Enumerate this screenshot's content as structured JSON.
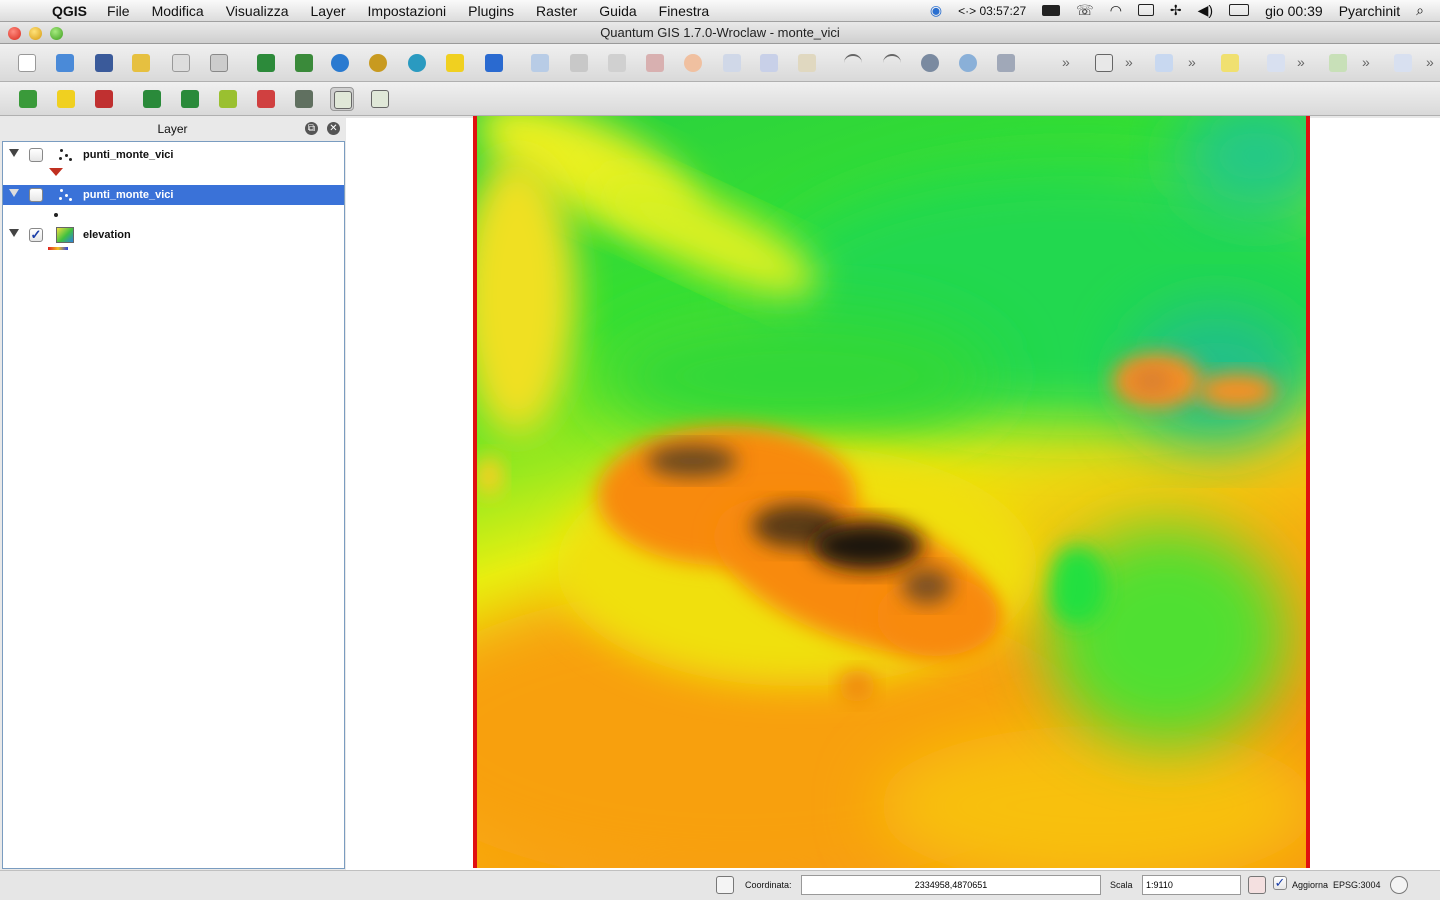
{
  "menubar": {
    "app_name": "QGIS",
    "items": [
      "File",
      "Modifica",
      "Visualizza",
      "Layer",
      "Impostazioni",
      "Plugins",
      "Raster",
      "Guida",
      "Finestra"
    ],
    "clock_elapsed": "<·> 03:57:27",
    "time": "gio 00:39",
    "user": "Pyarchinit"
  },
  "window": {
    "title": "Quantum GIS 1.7.0-Wroclaw - monte_vici"
  },
  "layer_panel": {
    "title": "Layer",
    "layers": [
      {
        "name": "punti_monte_vici",
        "checked": false,
        "selected": false
      },
      {
        "name": "punti_monte_vici",
        "checked": false,
        "selected": true
      },
      {
        "name": "elevation",
        "checked": true,
        "selected": false
      }
    ]
  },
  "statusbar": {
    "coord_label": "Coordinata:",
    "coord_value": "2334958,4870651",
    "scale_label": "Scala",
    "scale_value": "1:9110",
    "render_label": "Aggiorna",
    "crs": "EPSG:3004"
  },
  "colors": {
    "selection": "#3a72d8",
    "raster_border": "#e01010"
  }
}
